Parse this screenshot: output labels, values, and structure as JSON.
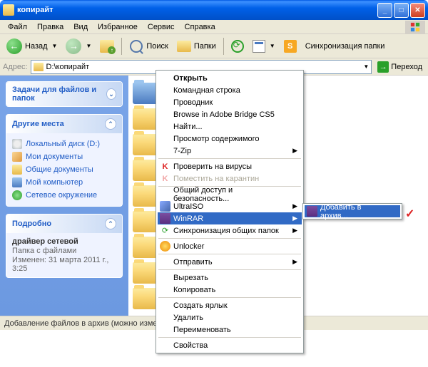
{
  "title": "копирайт",
  "menu": {
    "file": "Файл",
    "edit": "Правка",
    "view": "Вид",
    "favorites": "Избранное",
    "tools": "Сервис",
    "help": "Справка"
  },
  "toolbar": {
    "back": "Назад",
    "search": "Поиск",
    "folders": "Папки",
    "sync": "Синхронизация папки"
  },
  "address": {
    "label": "Адрес:",
    "value": "D:\\копирайт",
    "go": "Переход"
  },
  "sidebar": {
    "tasks_header": "Задачи для файлов и папок",
    "places_header": "Другие места",
    "places": [
      "Локальный диск (D:)",
      "Мои документы",
      "Общие документы",
      "Мой компьютер",
      "Сетевое окружение"
    ],
    "details_header": "Подробно",
    "details": {
      "name": "драйвер сетевой",
      "type": "Папка с файлами",
      "modified": "Изменен: 31 марта 2011 г., 3:25"
    }
  },
  "statusbar": "Добавление файлов в архив (можно изменять дополнит",
  "context": {
    "open": "Открыть",
    "cmdline": "Командная строка",
    "explorer": "Проводник",
    "bridge": "Browse in Adobe Bridge CS5",
    "find": "Найти...",
    "view_contents": "Просмотр содержимого",
    "sevenzip": "7-Zip",
    "virus": "Проверить на вирусы",
    "quarantine": "Поместить на карантин",
    "sharing": "Общий доступ и безопасность...",
    "ultraiso": "UltraISO",
    "winrar": "WinRAR",
    "sync_folders": "Синхронизация общих папок",
    "unlocker": "Unlocker",
    "sendto": "Отправить",
    "cut": "Вырезать",
    "copy": "Копировать",
    "shortcut": "Создать ярлык",
    "delete": "Удалить",
    "rename": "Переименовать",
    "properties": "Свойства"
  },
  "submenu": {
    "add_to_archive": "Добавить в архив..."
  }
}
